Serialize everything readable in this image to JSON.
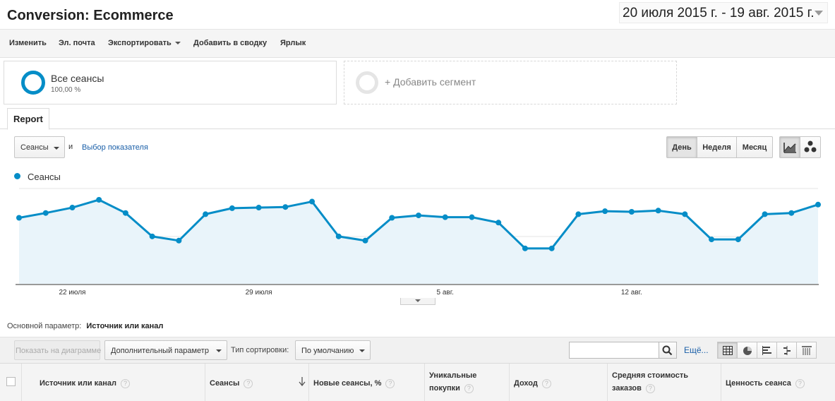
{
  "header": {
    "title": "Conversion: Ecommerce",
    "date_range": "20 июля 2015 г. - 19 авг. 2015 г."
  },
  "toolbar": {
    "edit": "Изменить",
    "email": "Эл. почта",
    "export": "Экспортировать",
    "add_to_dashboard": "Добавить в сводку",
    "shortcut": "Ярлык"
  },
  "segments": {
    "all_sessions_label": "Все сеансы",
    "all_sessions_pct": "100,00 %",
    "add_segment": "+ Добавить сегмент"
  },
  "tabs": [
    "Report"
  ],
  "chart_controls": {
    "metric": "Сеансы",
    "and": "и",
    "choose_metric": "Выбор показателя",
    "periods": [
      "День",
      "Неделя",
      "Месяц"
    ],
    "active_period": "День",
    "chart_types": [
      "line-chart-icon",
      "motion-chart-icon"
    ]
  },
  "chart_data": {
    "type": "area",
    "series": [
      {
        "name": "Сеансы",
        "color": "#058dc7",
        "values": [
          5.5,
          5.9,
          6.35,
          7.0,
          5.9,
          3.95,
          3.6,
          5.8,
          6.3,
          6.35,
          6.4,
          6.85,
          3.95,
          3.6,
          5.5,
          5.7,
          5.55,
          5.55,
          5.1,
          2.95,
          2.95,
          5.8,
          6.05,
          6.0,
          6.1,
          5.8,
          3.7,
          3.7,
          5.8,
          5.9,
          6.6
        ]
      }
    ],
    "x_tick_labels": [
      "22 июля",
      "29 июля",
      "5 авг.",
      "12 авг."
    ],
    "x_tick_indices": [
      2,
      9,
      16,
      23
    ],
    "ylim": [
      0,
      8
    ],
    "grid": true
  },
  "report": {
    "primary_dimension_label": "Основной параметр:",
    "primary_dimension_value": "Источник или канал",
    "plot_rows": "Показать на диаграмме",
    "secondary_dimension": "Дополнительный параметр",
    "sort_type_label": "Тип сортировки:",
    "sort_type_value": "По умолчанию",
    "more": "Ещё...",
    "columns": [
      {
        "label": "Источник или канал"
      },
      {
        "label": "Сеансы"
      },
      {
        "label": "Новые сеансы, %"
      },
      {
        "label": "Уникальные покупки"
      },
      {
        "label": "Доход"
      },
      {
        "label": "Средняя стоимость заказов"
      },
      {
        "label": "Ценность сеанса"
      }
    ],
    "help_glyph": "?"
  }
}
